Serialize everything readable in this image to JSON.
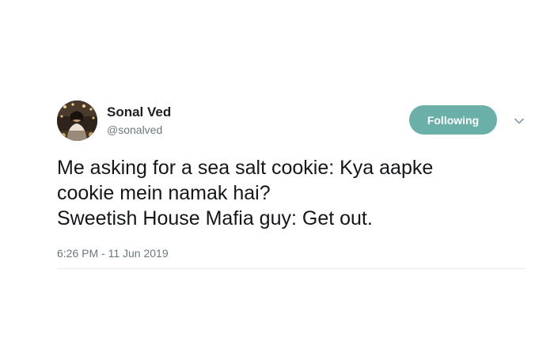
{
  "author": {
    "display_name": "Sonal Ved",
    "handle": "@sonalved"
  },
  "follow_button": {
    "label": "Following",
    "color": "#6ab0a8"
  },
  "menu_icon": "chevron-down-icon",
  "tweet": {
    "lines": [
      "Me asking for a sea salt cookie: Kya aapke",
      "cookie mein namak hai?",
      "Sweetish House Mafia guy: Get out."
    ],
    "timestamp": "6:26 PM - 11 Jun 2019"
  }
}
